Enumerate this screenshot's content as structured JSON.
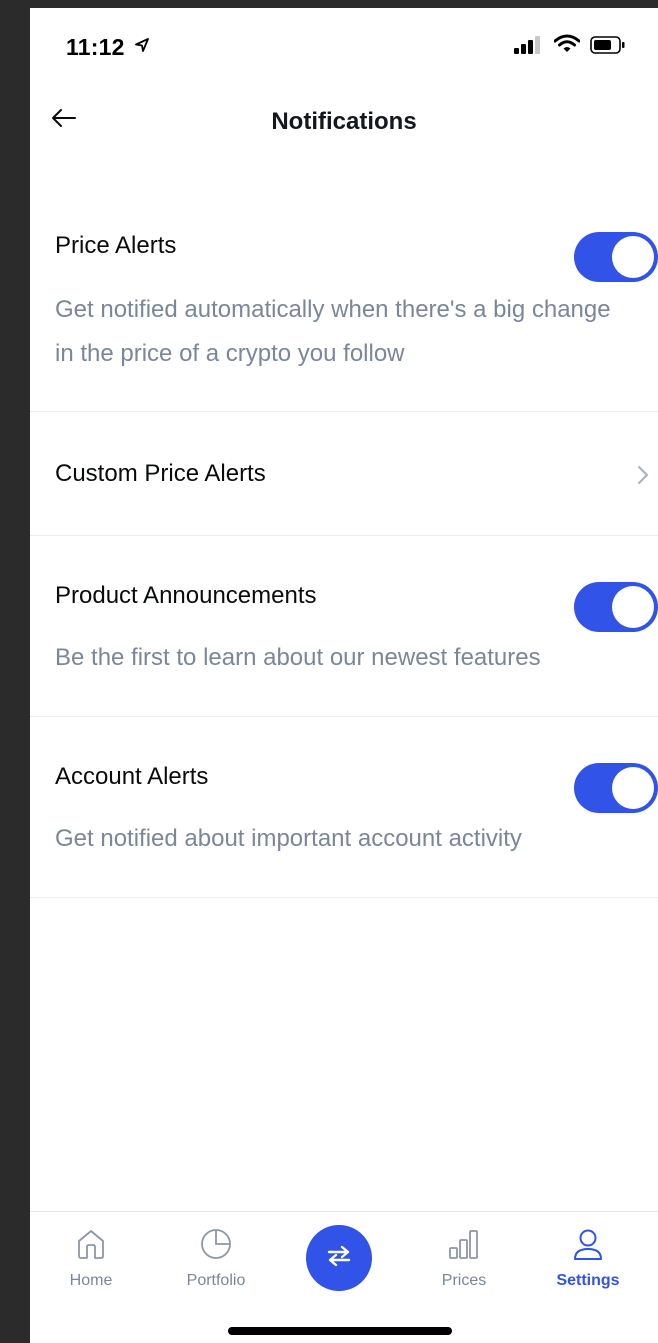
{
  "status_bar": {
    "time": "11:12"
  },
  "header": {
    "title": "Notifications"
  },
  "settings": [
    {
      "title": "Price Alerts",
      "description": "Get notified automatically when there's a big change in the price of a crypto you follow",
      "toggle_on": true
    },
    {
      "title": "Custom Price Alerts",
      "has_chevron": true
    },
    {
      "title": "Product Announcements",
      "description": "Be the first to learn about our newest features",
      "toggle_on": true
    },
    {
      "title": "Account Alerts",
      "description": "Get notified about important account activity",
      "toggle_on": true
    }
  ],
  "tabbar": {
    "home": "Home",
    "portfolio": "Portfolio",
    "prices": "Prices",
    "settings": "Settings",
    "active": "settings"
  },
  "colors": {
    "accent": "#3153e8",
    "description_text": "#7a8799",
    "title_text": "#0a0b0d",
    "divider": "#ececef"
  },
  "icons": {
    "back": "arrow-left-icon",
    "chevron": "chevron-right-icon",
    "home": "home-icon",
    "portfolio": "pie-chart-icon",
    "trade": "swap-arrows-icon",
    "prices": "bar-chart-icon",
    "settings": "user-icon"
  }
}
